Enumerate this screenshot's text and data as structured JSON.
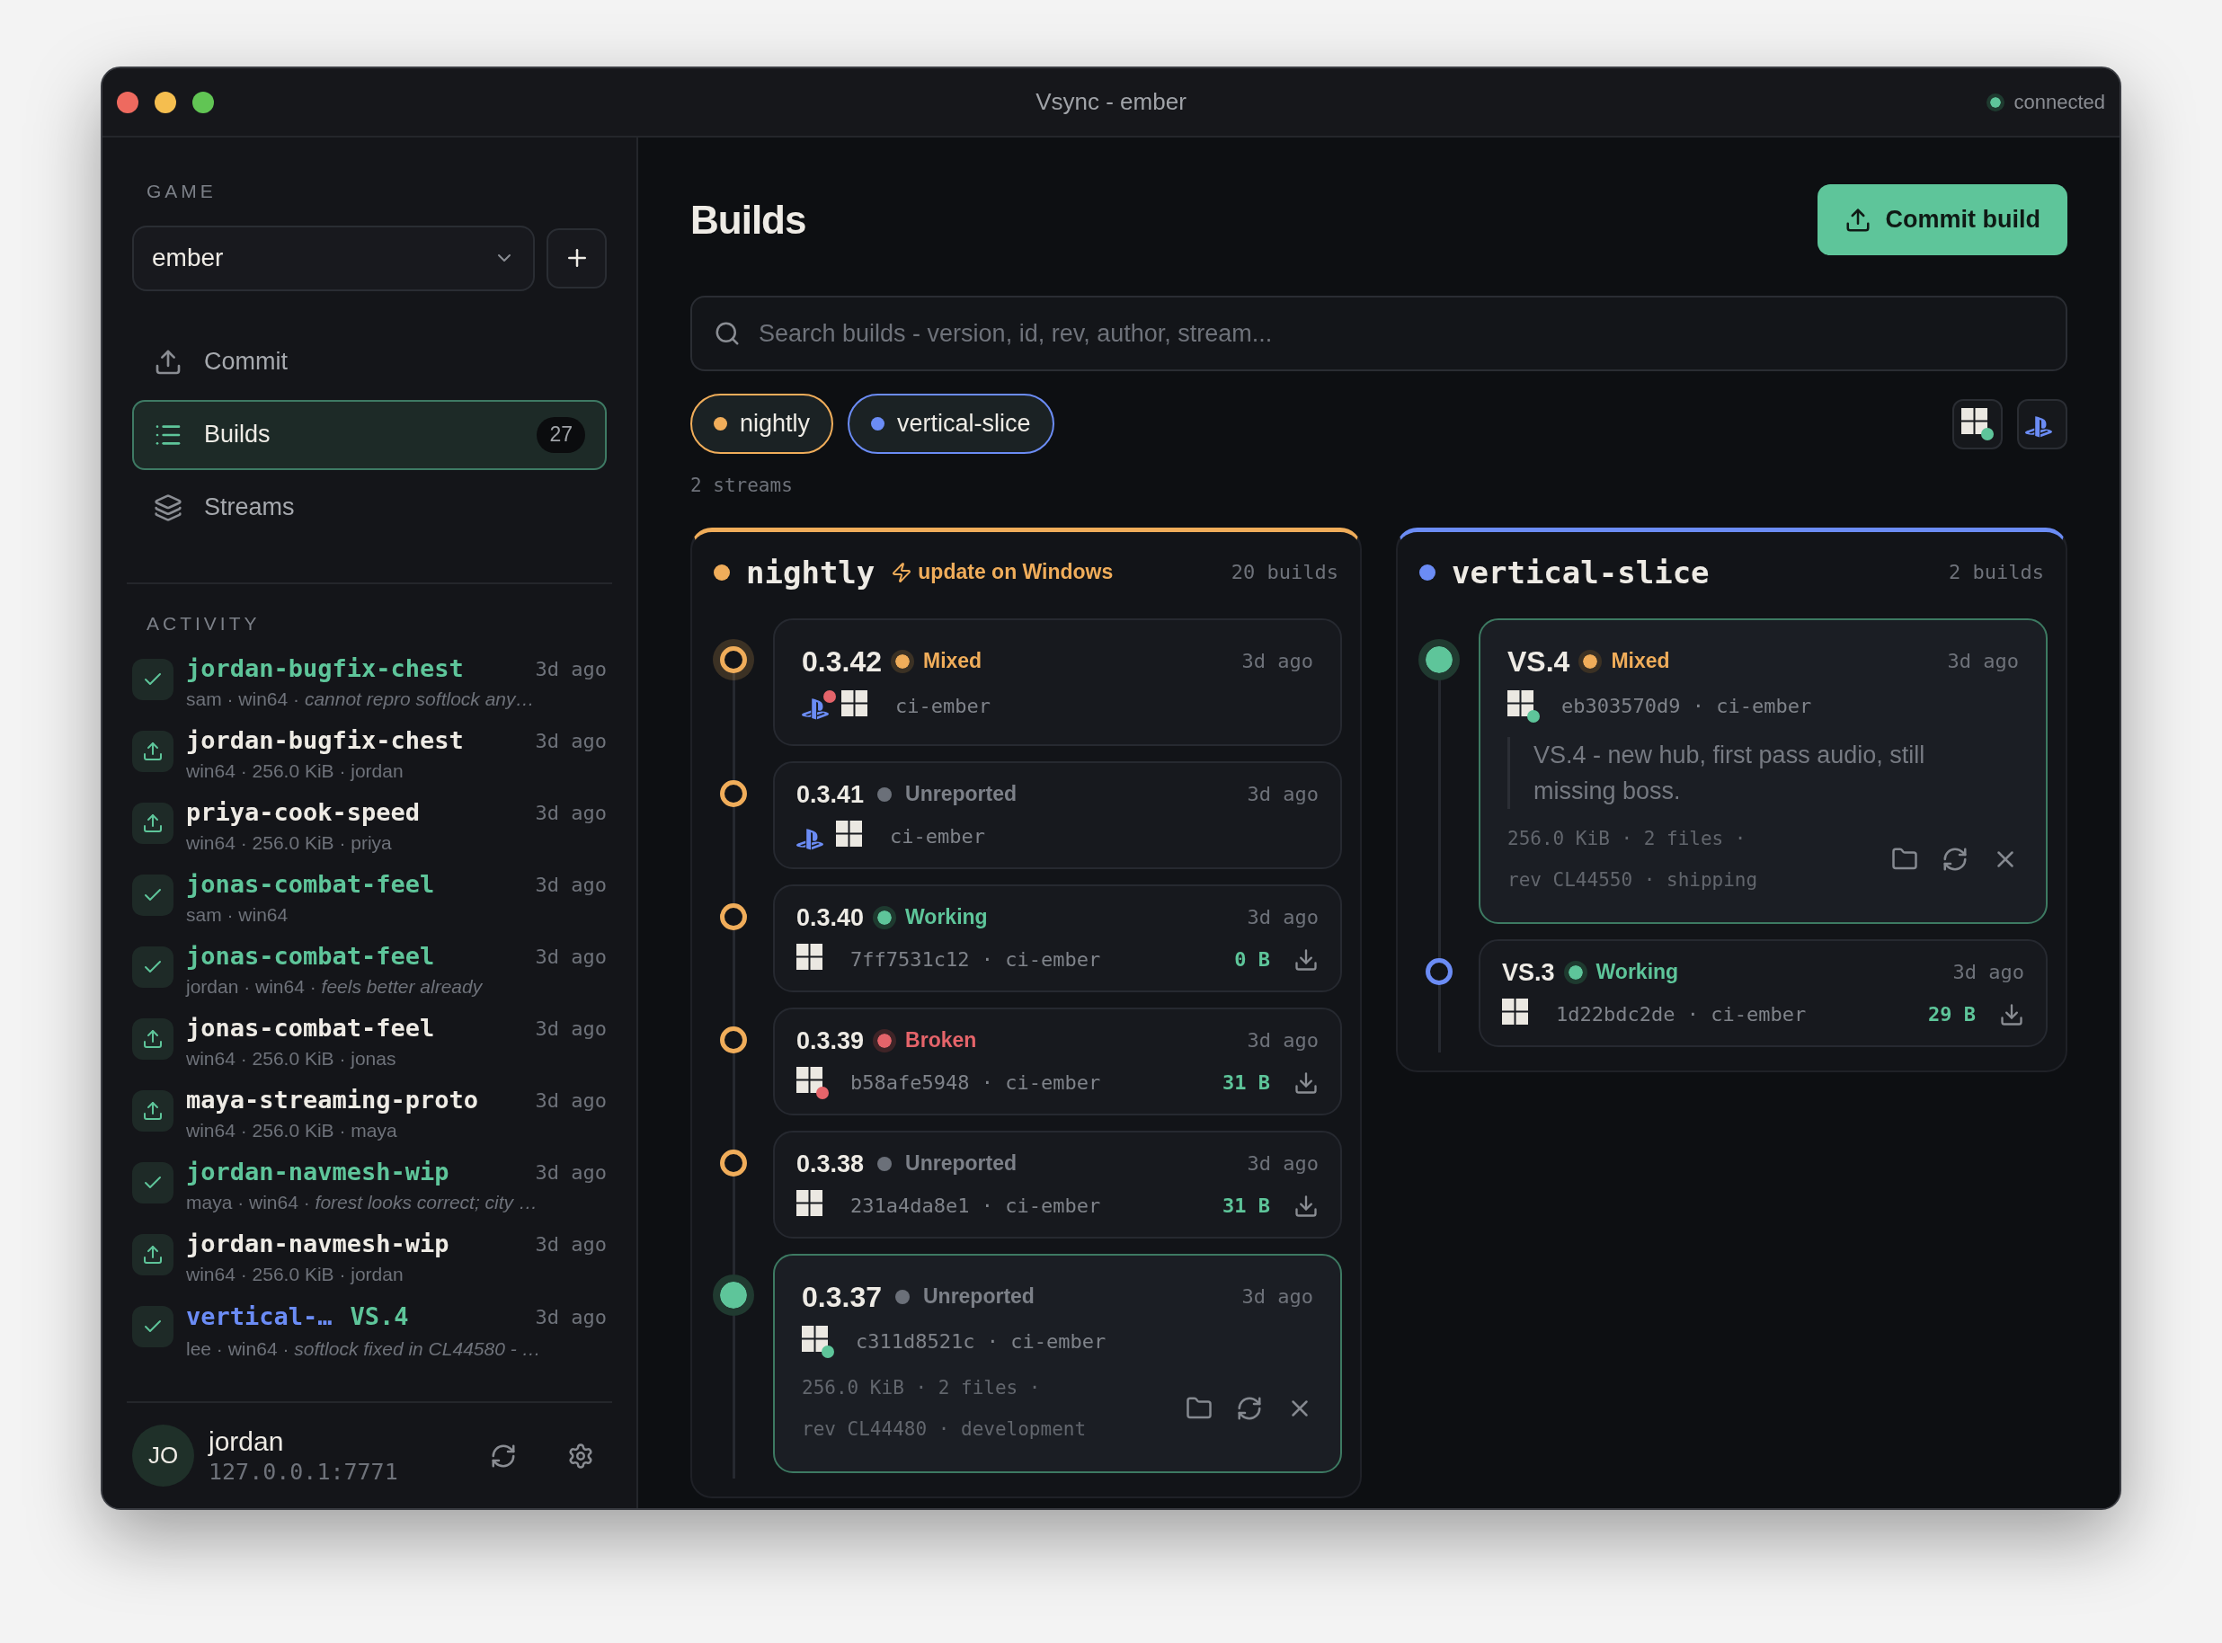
{
  "window": {
    "title": "Vsync - ember",
    "connection": {
      "label": "connected",
      "color": "#5ec59a"
    }
  },
  "sidebar": {
    "game_label": "GAME",
    "game_select": {
      "value": "ember"
    },
    "nav": [
      {
        "kind": "commit",
        "label": "Commit",
        "selected": false
      },
      {
        "kind": "builds",
        "label": "Builds",
        "selected": true,
        "count": "27"
      },
      {
        "kind": "streams",
        "label": "Streams",
        "selected": false
      }
    ],
    "activity_label": "ACTIVITY",
    "activity": [
      {
        "kind": "report",
        "title": "jordan-bugfix-chest",
        "time": "3d ago",
        "meta": "sam · win64 · *cannot repro softlock any…*"
      },
      {
        "kind": "commit",
        "title": "jordan-bugfix-chest",
        "time": "3d ago",
        "meta": "win64 · 256.0 KiB · jordan"
      },
      {
        "kind": "commit",
        "title": "priya-cook-speed",
        "time": "3d ago",
        "meta": "win64 · 256.0 KiB · priya"
      },
      {
        "kind": "report",
        "title": "jonas-combat-feel",
        "time": "3d ago",
        "meta": "sam · win64"
      },
      {
        "kind": "report",
        "title": "jonas-combat-feel",
        "time": "3d ago",
        "meta": "jordan · win64 · *feels better already*"
      },
      {
        "kind": "commit",
        "title": "jonas-combat-feel",
        "time": "3d ago",
        "meta": "win64 · 256.0 KiB · jonas"
      },
      {
        "kind": "commit",
        "title": "maya-streaming-proto",
        "time": "3d ago",
        "meta": "win64 · 256.0 KiB · maya"
      },
      {
        "kind": "report",
        "title": "jordan-navmesh-wip",
        "time": "3d ago",
        "meta": "maya · win64 · *forest looks correct; city …*"
      },
      {
        "kind": "commit",
        "title": "jordan-navmesh-wip",
        "time": "3d ago",
        "meta": "win64 · 256.0 KiB · jordan"
      },
      {
        "kind": "report",
        "stream": {
          "label": "vertical-…",
          "color": "#6b8cf5"
        },
        "title": "VS.4",
        "time": "3d ago",
        "meta": "lee · win64 · *softlock fixed in CL44580 - …*"
      }
    ],
    "user": {
      "initials": "JO",
      "name": "jordan",
      "address": "127.0.0.1:7771"
    }
  },
  "main": {
    "title": "Builds",
    "commit_button": "Commit build",
    "search": {
      "placeholder": "Search builds - version, id, rev, author, stream..."
    },
    "stream_filters": [
      {
        "label": "nightly",
        "color": "#f0ad5a",
        "selected": true
      },
      {
        "label": "vertical-slice",
        "color": "#6b8cf5",
        "selected": true
      }
    ],
    "platform_filters": [
      {
        "kind": "windows",
        "color": "#5ec59a"
      },
      {
        "kind": "playstation"
      }
    ],
    "stream_count": "2 streams",
    "streams": [
      {
        "name": "nightly",
        "color": "#f0ad5a",
        "notice": "update on Windows",
        "count": "20 builds",
        "builds": [
          {
            "version": "0.3.42",
            "status": {
              "label": "Mixed",
              "kind": "mixed"
            },
            "time": "3d ago",
            "latest": true,
            "selected": false,
            "platforms": [
              {
                "kind": "playstation",
                "color": "#e5646a"
              },
              {
                "kind": "windows"
              }
            ],
            "source": "ci-ember"
          },
          {
            "version": "0.3.41",
            "status": {
              "label": "Unreported",
              "kind": "unreported"
            },
            "time": "3d ago",
            "latest": false,
            "selected": false,
            "platforms": [
              {
                "kind": "playstation"
              },
              {
                "kind": "windows"
              }
            ],
            "source": "ci-ember"
          },
          {
            "version": "0.3.40",
            "status": {
              "label": "Working",
              "kind": "working"
            },
            "time": "3d ago",
            "latest": false,
            "selected": false,
            "platforms": [
              {
                "kind": "windows"
              }
            ],
            "source": "7ff7531c12 · ci-ember",
            "size": "0 B"
          },
          {
            "version": "0.3.39",
            "status": {
              "label": "Broken",
              "kind": "broken"
            },
            "time": "3d ago",
            "latest": false,
            "selected": false,
            "platforms": [
              {
                "kind": "windows",
                "color": "#e5646a"
              }
            ],
            "source": "b58afe5948 · ci-ember",
            "size": "31 B"
          },
          {
            "version": "0.3.38",
            "status": {
              "label": "Unreported",
              "kind": "unreported"
            },
            "time": "3d ago",
            "latest": false,
            "selected": false,
            "platforms": [
              {
                "kind": "windows"
              }
            ],
            "source": "231a4da8e1 · ci-ember",
            "size": "31 B"
          },
          {
            "version": "0.3.37",
            "status": {
              "label": "Unreported",
              "kind": "unreported"
            },
            "time": "3d ago",
            "latest": false,
            "selected": true,
            "platforms": [
              {
                "kind": "windows",
                "color": "#5ec59a"
              }
            ],
            "source": "c311d8521c · ci-ember",
            "details": [
              "256.0 KiB · 2 files ·",
              "rev CL44480 · development"
            ]
          }
        ]
      },
      {
        "name": "vertical-slice",
        "color": "#6b8cf5",
        "count": "2 builds",
        "builds": [
          {
            "version": "VS.4",
            "status": {
              "label": "Mixed",
              "kind": "mixed"
            },
            "time": "3d ago",
            "latest": true,
            "selected": true,
            "platforms": [
              {
                "kind": "windows",
                "color": "#5ec59a"
              }
            ],
            "source": "eb303570d9 · ci-ember",
            "note": "VS.4 - new hub, first pass audio, still missing boss.",
            "details": [
              "256.0 KiB · 2 files ·",
              "rev CL44550 · shipping"
            ]
          },
          {
            "version": "VS.3",
            "status": {
              "label": "Working",
              "kind": "working"
            },
            "time": "3d ago",
            "latest": false,
            "selected": false,
            "platforms": [
              {
                "kind": "windows"
              }
            ],
            "source": "1d22bdc2de · ci-ember",
            "size": "29 B"
          }
        ]
      }
    ]
  }
}
